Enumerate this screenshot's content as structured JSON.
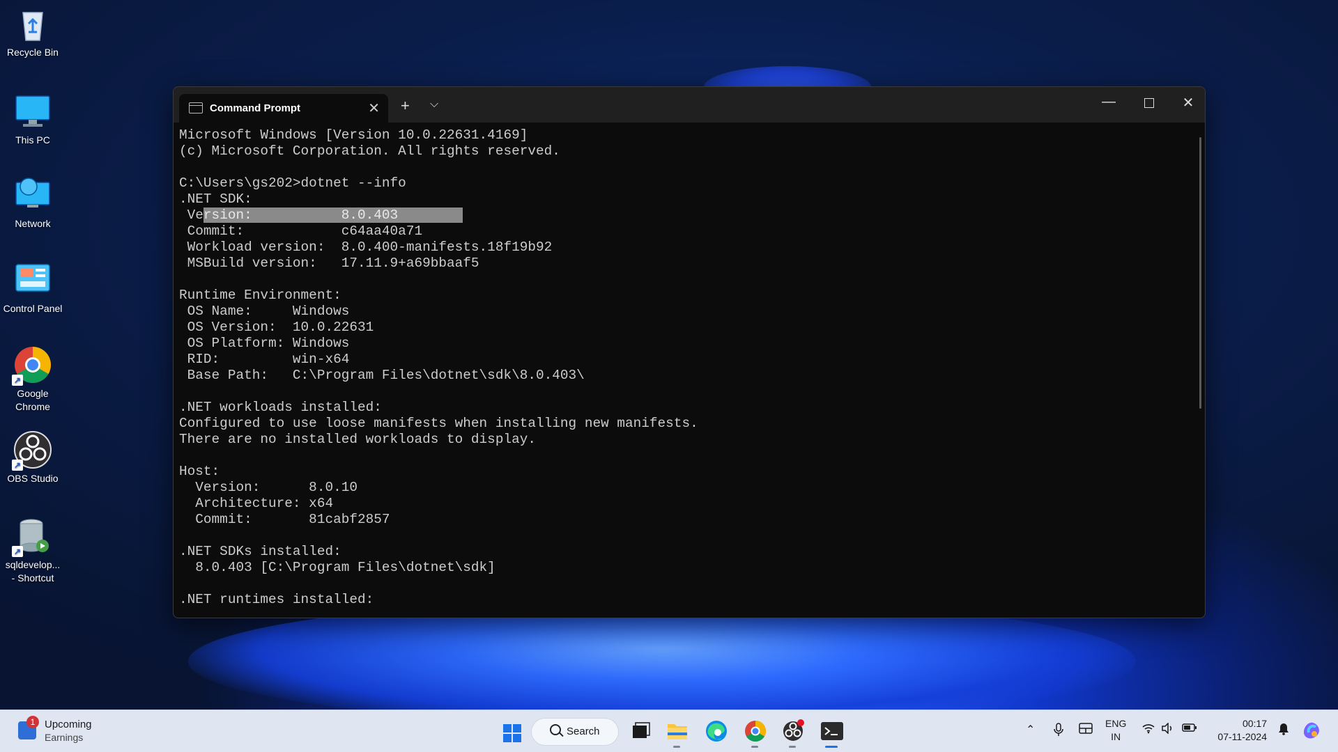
{
  "desktop": {
    "icons": [
      {
        "label": "Recycle Bin"
      },
      {
        "label": "This PC"
      },
      {
        "label": "Network"
      },
      {
        "label": "Control Panel"
      },
      {
        "label": "Google\nChrome"
      },
      {
        "label": "OBS Studio"
      },
      {
        "label": "sqldevelop...\n- Shortcut"
      }
    ]
  },
  "window": {
    "tab_title": "Command Prompt",
    "new_tab": "+",
    "dropdown": "⌵",
    "close_tab": "✕",
    "minimize": "—",
    "close": "✕"
  },
  "console": {
    "lines": [
      "Microsoft Windows [Version 10.0.22631.4169]",
      "(c) Microsoft Corporation. All rights reserved.",
      "",
      "C:\\Users\\gs202>dotnet --info",
      ".NET SDK:",
      " Version:           8.0.403",
      " Commit:            c64aa40a71",
      " Workload version:  8.0.400-manifests.18f19b92",
      " MSBuild version:   17.11.9+a69bbaaf5",
      "",
      "Runtime Environment:",
      " OS Name:     Windows",
      " OS Version:  10.0.22631",
      " OS Platform: Windows",
      " RID:         win-x64",
      " Base Path:   C:\\Program Files\\dotnet\\sdk\\8.0.403\\",
      "",
      ".NET workloads installed:",
      "Configured to use loose manifests when installing new manifests.",
      "There are no installed workloads to display.",
      "",
      "Host:",
      "  Version:      8.0.10",
      "  Architecture: x64",
      "  Commit:       81cabf2857",
      "",
      ".NET SDKs installed:",
      "  8.0.403 [C:\\Program Files\\dotnet\\sdk]",
      "",
      ".NET runtimes installed:"
    ],
    "selection": {
      "before": " Ve",
      "selected": "rsion:           8.0.403        ",
      "line_index": 5
    }
  },
  "taskbar": {
    "widget": {
      "badge": "1",
      "title": "Upcoming",
      "subtitle": "Earnings"
    },
    "search_label": "Search",
    "apps": [
      "file-explorer",
      "edge",
      "chrome",
      "obs",
      "terminal"
    ],
    "tray": {
      "lang_top": "ENG",
      "lang_bottom": "IN",
      "time": "00:17",
      "date": "07-11-2024"
    }
  }
}
